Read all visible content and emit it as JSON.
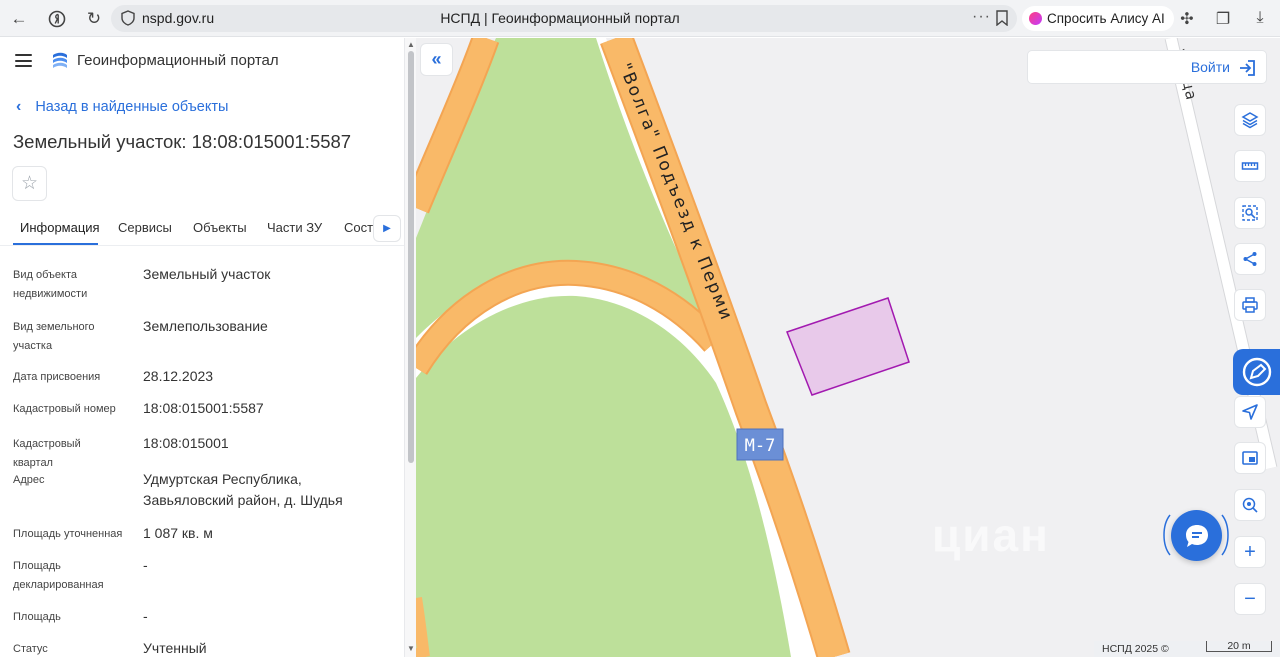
{
  "browser": {
    "url": "nspd.gov.ru",
    "tab_title": "НСПД | Геоинформационный портал",
    "alice_label": "Спросить Алису AI"
  },
  "panel": {
    "portal_name": "Геоинформационный портал",
    "back_label": "Назад в найденные объекты",
    "object_title": "Земельный участок: 18:08:015001:5587",
    "tabs": [
      {
        "label": "Информация"
      },
      {
        "label": "Сервисы"
      },
      {
        "label": "Объекты"
      },
      {
        "label": "Части ЗУ"
      },
      {
        "label": "Состав"
      }
    ],
    "fields": [
      {
        "label": "Вид объекта недвижимости",
        "value": "Земельный участок"
      },
      {
        "label": "Вид земельного участка",
        "value": "Землепользование"
      },
      {
        "label": "Дата присвоения",
        "value": "28.12.2023"
      },
      {
        "label": "Кадастровый номер",
        "value": "18:08:015001:5587"
      },
      {
        "label": "Кадастровый квартал",
        "value": "18:08:015001"
      },
      {
        "label": "Адрес",
        "value": "Удмуртская Республика, Завьяловский район, д. Шудья"
      },
      {
        "label": "Площадь уточненная",
        "value": "1 087 кв. м"
      },
      {
        "label": "Площадь декларированная",
        "value": "-"
      },
      {
        "label": "Площадь",
        "value": "-"
      },
      {
        "label": "Статус",
        "value": "Учтенный"
      }
    ]
  },
  "map": {
    "login_label": "Войти",
    "road_label": "\"Волга\" Подъезд к Перми",
    "street_label": "улица",
    "route_shield": "М-7",
    "footer_copy": "НСПД 2025 ©",
    "scale_label": "20 m",
    "watermark": "циан",
    "zoom_in": "+",
    "zoom_out": "−"
  },
  "colors": {
    "accent": "#2a6fdb",
    "road": "#f9b968",
    "road_edge": "#f3a553",
    "greenery": "#bde09a",
    "parcel_fill": "#e8c9ea",
    "parcel_stroke": "#a21ab0",
    "map_bg": "#f0f0f2"
  }
}
